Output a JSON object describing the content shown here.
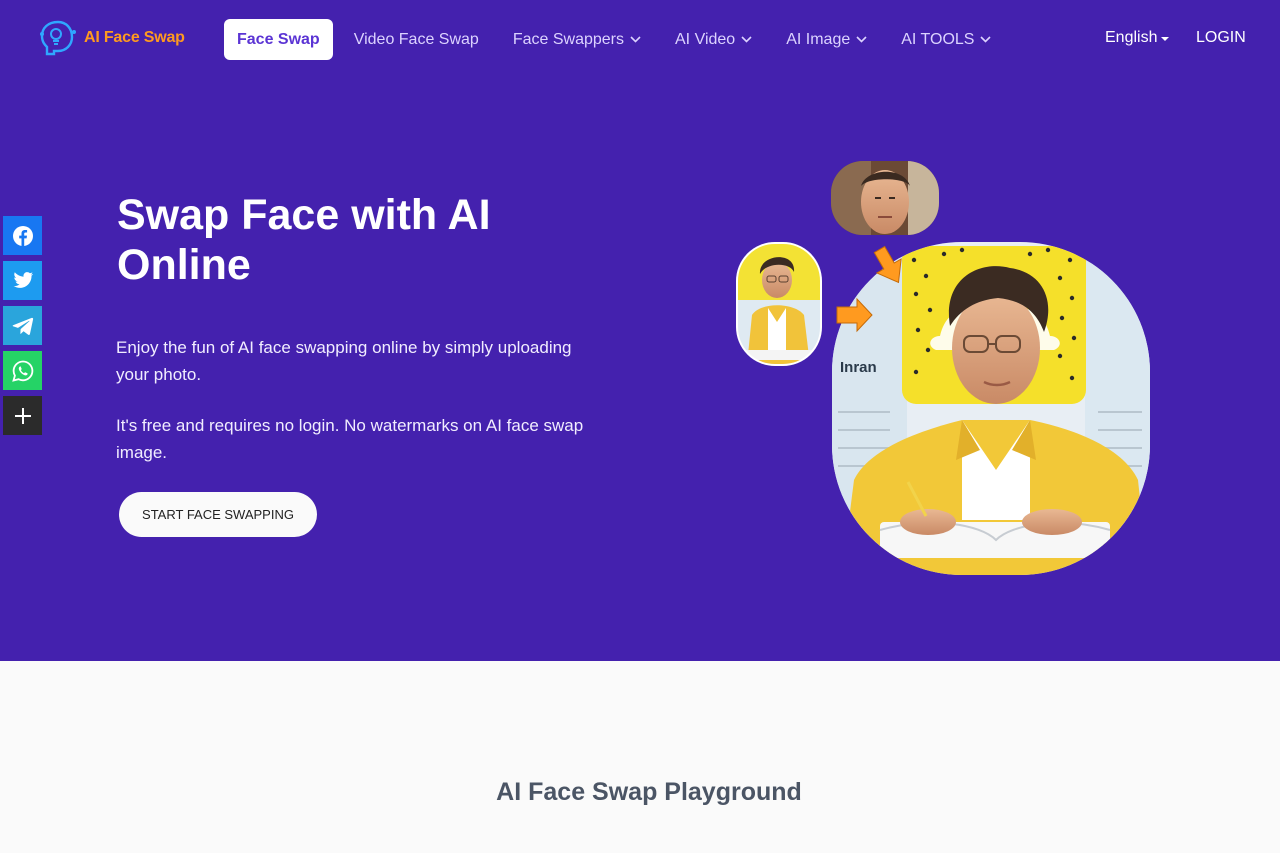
{
  "header": {
    "logo_text": "AI Face Swap",
    "nav": [
      {
        "label": "Face Swap",
        "active": true,
        "dropdown": false
      },
      {
        "label": "Video Face Swap",
        "active": false,
        "dropdown": false
      },
      {
        "label": "Face Swappers",
        "active": false,
        "dropdown": true
      },
      {
        "label": "AI Video",
        "active": false,
        "dropdown": true
      },
      {
        "label": "AI Image",
        "active": false,
        "dropdown": true
      },
      {
        "label": "AI TOOLS",
        "active": false,
        "dropdown": true
      }
    ],
    "language": "English",
    "login": "LOGIN"
  },
  "share": [
    {
      "name": "facebook-icon"
    },
    {
      "name": "twitter-icon"
    },
    {
      "name": "telegram-icon"
    },
    {
      "name": "whatsapp-icon"
    },
    {
      "name": "plus-icon"
    }
  ],
  "hero": {
    "title": "Swap Face with AI Online",
    "paragraph1": "Enjoy the fun of AI face swapping online by simply uploading your photo.",
    "paragraph2": "It's free and requires no login. No watermarks on AI face swap image.",
    "cta": "START FACE SWAPPING",
    "illustration_name": "Inran"
  },
  "playground": {
    "title": "AI Face Swap Playground"
  },
  "colors": {
    "hero_bg": "#4421ae",
    "accent": "#5b34d4",
    "logo": "#ff9a1f",
    "arrow": "#ff9a1f"
  }
}
